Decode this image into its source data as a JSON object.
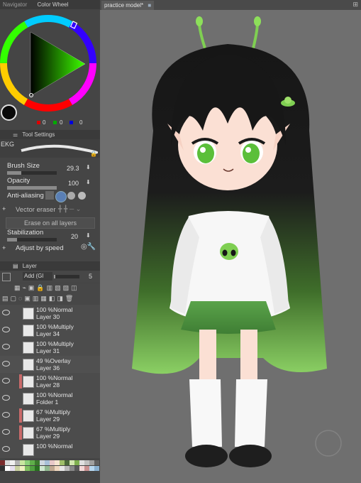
{
  "panels": {
    "navigator_tab": "Navigator",
    "color_wheel_tab": "Color Wheel",
    "tool_settings_title": "Tool Settings",
    "layer_title": "Layer"
  },
  "color": {
    "main": "#0a0a0a",
    "channels": [
      "0",
      "0",
      "0"
    ]
  },
  "tool": {
    "brush_name": "EKG",
    "brush_size_label": "Brush Size",
    "brush_size_value": "29.3",
    "brush_size_level": 0.29,
    "opacity_label": "Opacity",
    "opacity_value": "100",
    "opacity_level": 1.0,
    "antialias_label": "Anti-aliasing",
    "vector_eraser_label": "Vector eraser",
    "erase_all_label": "Erase on all layers",
    "stabilization_label": "Stabilization",
    "stabilization_value": "20",
    "adjust_speed_label": "Adjust by speed"
  },
  "layer_panel": {
    "blend_mode": "Add (Gl",
    "opacity_value": "5"
  },
  "layers": [
    {
      "line1": "100 %Normal",
      "line2": "Layer 30"
    },
    {
      "line1": "100 %Multiply",
      "line2": "Layer 34"
    },
    {
      "line1": "100 %Multiply",
      "line2": "Layer 31"
    },
    {
      "line1": "49 %Overlay",
      "line2": "Layer 36"
    },
    {
      "line1": "100 %Normal",
      "line2": "Layer 28"
    },
    {
      "line1": "100 %Normal",
      "line2": "Folder 1"
    },
    {
      "line1": "67 %Multiply",
      "line2": "Layer 29"
    },
    {
      "line1": "67 %Multiply",
      "line2": "Layer 29"
    },
    {
      "line1": "100 %Normal",
      "line2": ""
    }
  ],
  "canvas": {
    "tab_title": "practice model*"
  },
  "palette_colors": [
    "#7a2c2c",
    "#d8d8d8",
    "#f0f0f0",
    "#b0b0b0",
    "#c9e6a0",
    "#8dd07a",
    "#5fae4a",
    "#3a7a2c",
    "#cfd8e0",
    "#a8c0d8",
    "#e8c8c8",
    "#f6e4d0",
    "#9fbf6a",
    "#4a6a3a",
    "#d4e8b0",
    "#7fb050",
    "#e0e0e0",
    "#c0c0c0",
    "#a0a0a0",
    "#606060",
    "#303030",
    "#ffffff",
    "#e8e0f0",
    "#c8d0a0",
    "#f0f0c0",
    "#80c060",
    "#50a040",
    "#287020",
    "#d0e8d0",
    "#90b890",
    "#c0a890",
    "#f0d8c0",
    "#e8e8e8",
    "#b8b8b8",
    "#888888",
    "#585858",
    "#f4d8d8",
    "#c89090",
    "#b8d8f0",
    "#88b0d0"
  ]
}
